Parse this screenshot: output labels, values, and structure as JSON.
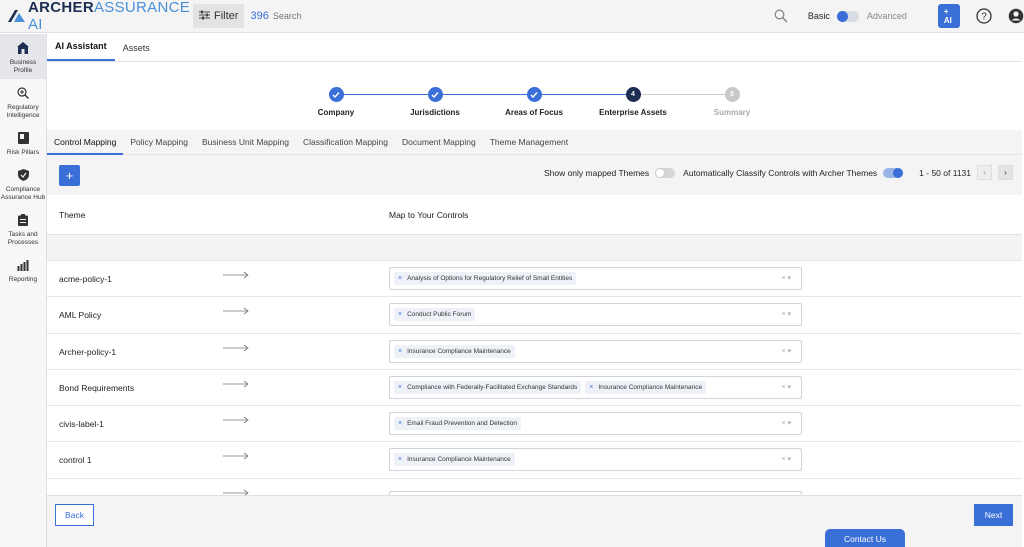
{
  "app": {
    "logo_primary": "ARCHER",
    "logo_secondary": "ASSURANCE AI"
  },
  "topbar": {
    "filter_label": "Filter",
    "filter_count": "396",
    "search_placeholder": "Search",
    "mode_basic": "Basic",
    "mode_advanced": "Advanced",
    "ai_button": "+ AI"
  },
  "sidebar": {
    "items": [
      {
        "label": "Business Profile",
        "icon": "home-icon"
      },
      {
        "label": "Regulatory Intelligence",
        "icon": "magnifier-plus-icon"
      },
      {
        "label": "Risk Pillars",
        "icon": "book-icon"
      },
      {
        "label": "Compliance Assurance Hub",
        "icon": "shield-check-icon"
      },
      {
        "label": "Tasks and Processes",
        "icon": "clipboard-icon"
      },
      {
        "label": "Reporting",
        "icon": "bar-chart-icon"
      }
    ]
  },
  "top_tabs": [
    "AI Assistant",
    "Assets"
  ],
  "stepper": {
    "steps": [
      {
        "label": "Company",
        "state": "done",
        "number": ""
      },
      {
        "label": "Jurisdictions",
        "state": "done",
        "number": ""
      },
      {
        "label": "Areas of Focus",
        "state": "done",
        "number": ""
      },
      {
        "label": "Enterprise Assets",
        "state": "current",
        "number": "4"
      },
      {
        "label": "Summary",
        "state": "pending",
        "number": "5"
      }
    ]
  },
  "mapping_tabs": [
    "Control Mapping",
    "Policy Mapping",
    "Business Unit Mapping",
    "Classification Mapping",
    "Document Mapping",
    "Theme Management"
  ],
  "toolbar": {
    "add_label": "+",
    "show_mapped_label": "Show only mapped Themes",
    "auto_classify_label": "Automatically Classify Controls with Archer Themes",
    "pagination": "1 - 50 of 1131",
    "prev": "‹",
    "next": "›"
  },
  "table": {
    "col_theme": "Theme",
    "col_controls": "Map to Your Controls",
    "rows": [
      {
        "theme": "acme-policy-1",
        "controls": [
          "Analysis of Options for Regulatory Relief of Small Entities"
        ]
      },
      {
        "theme": "AML Policy",
        "controls": [
          "Conduct Public Forum"
        ]
      },
      {
        "theme": "Archer-policy-1",
        "controls": [
          "Insurance Compliance Maintenance"
        ]
      },
      {
        "theme": "Bond Requirements",
        "controls": [
          "Compliance with Federally-Facilitated Exchange Standards",
          "Insurance Compliance Maintenance"
        ]
      },
      {
        "theme": "civis-label-1",
        "controls": [
          "Email Fraud Prevention and Detection"
        ]
      },
      {
        "theme": "control 1",
        "controls": [
          "Insurance Compliance Maintenance"
        ]
      }
    ]
  },
  "footer": {
    "back": "Back",
    "next": "Next",
    "contact": "Contact Us"
  },
  "colors": {
    "accent": "#3a6fd8",
    "brand_dark": "#1c2e52"
  }
}
